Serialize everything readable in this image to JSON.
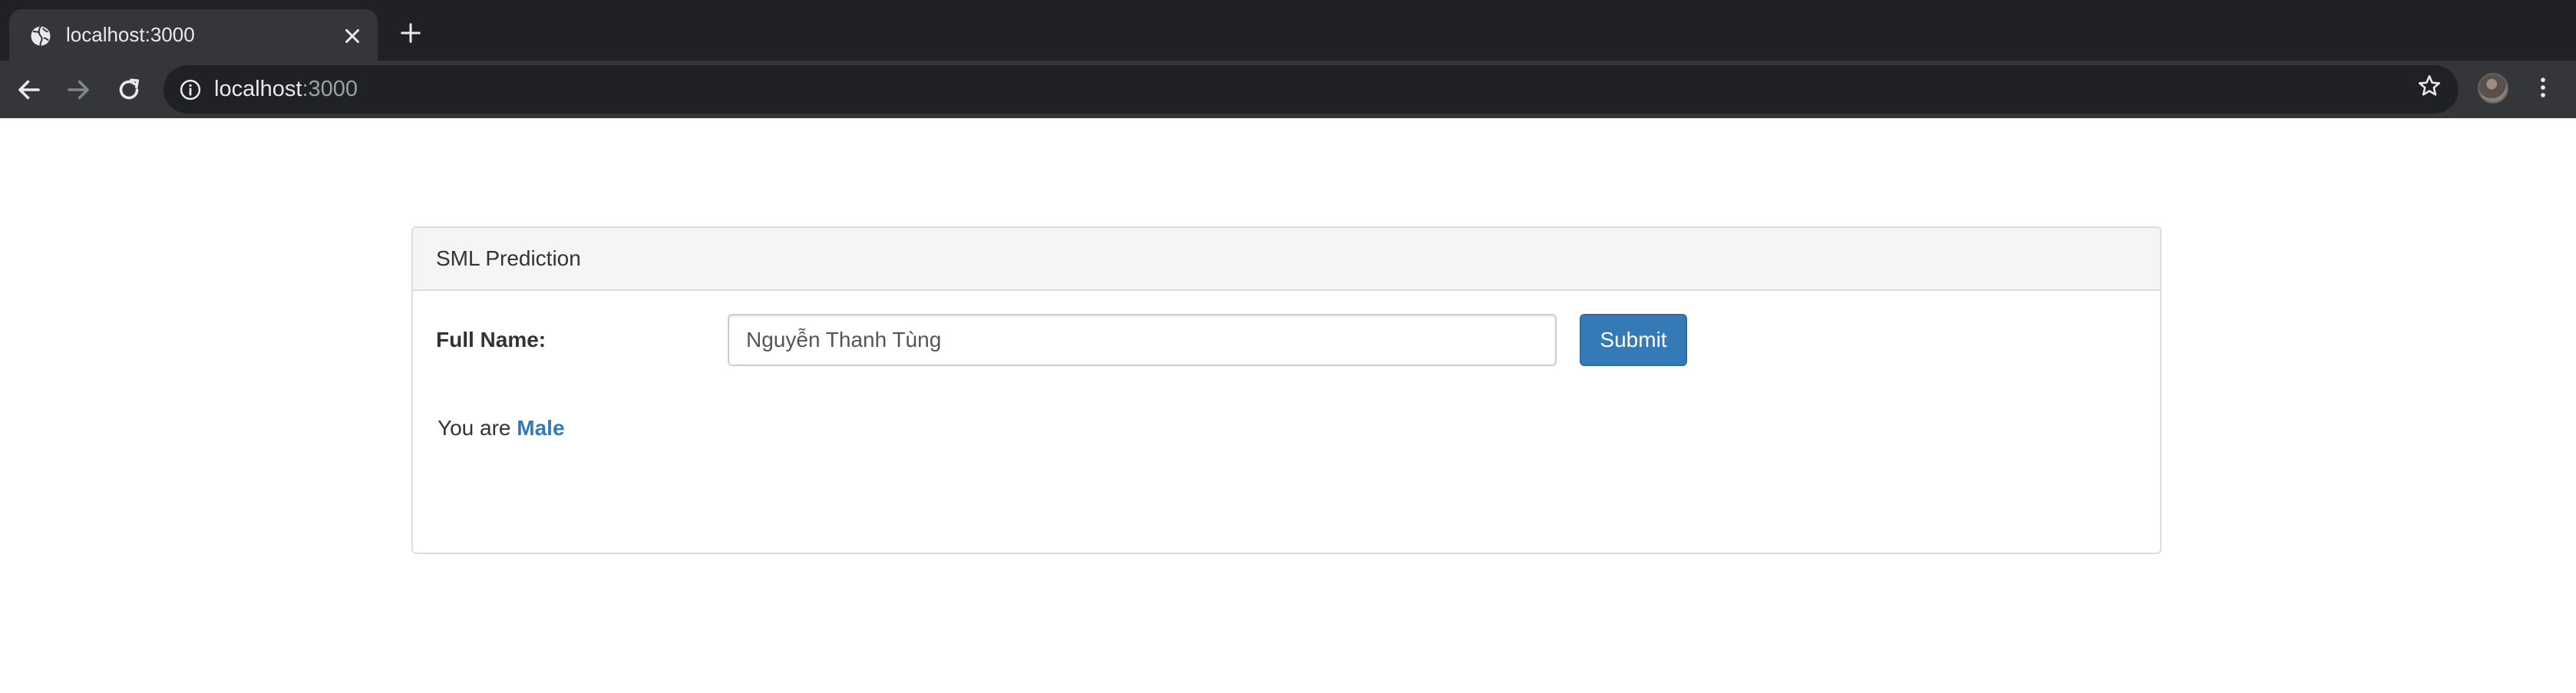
{
  "browser": {
    "tab": {
      "title": "localhost:3000",
      "favicon": "globe-icon"
    },
    "address_bar": {
      "host": "localhost",
      "port": ":3000"
    },
    "icons": {
      "back": "arrow-left-icon",
      "forward": "arrow-right-icon",
      "reload": "reload-icon",
      "info": "info-icon",
      "bookmark": "star-icon",
      "menu": "kebab-menu-icon",
      "close_tab": "close-icon",
      "new_tab": "plus-icon"
    }
  },
  "panel": {
    "heading": "SML Prediction",
    "form": {
      "label": "Full Name:",
      "input_value": "Nguyễn Thanh Tùng",
      "submit_label": "Submit"
    },
    "result": {
      "prefix": "You are",
      "value": "Male"
    }
  },
  "colors": {
    "primary": "#337ab7",
    "chrome_dark": "#202124",
    "chrome_toolbar": "#35363a",
    "panel_border": "#dddddd",
    "panel_heading_bg": "#f5f5f5"
  }
}
